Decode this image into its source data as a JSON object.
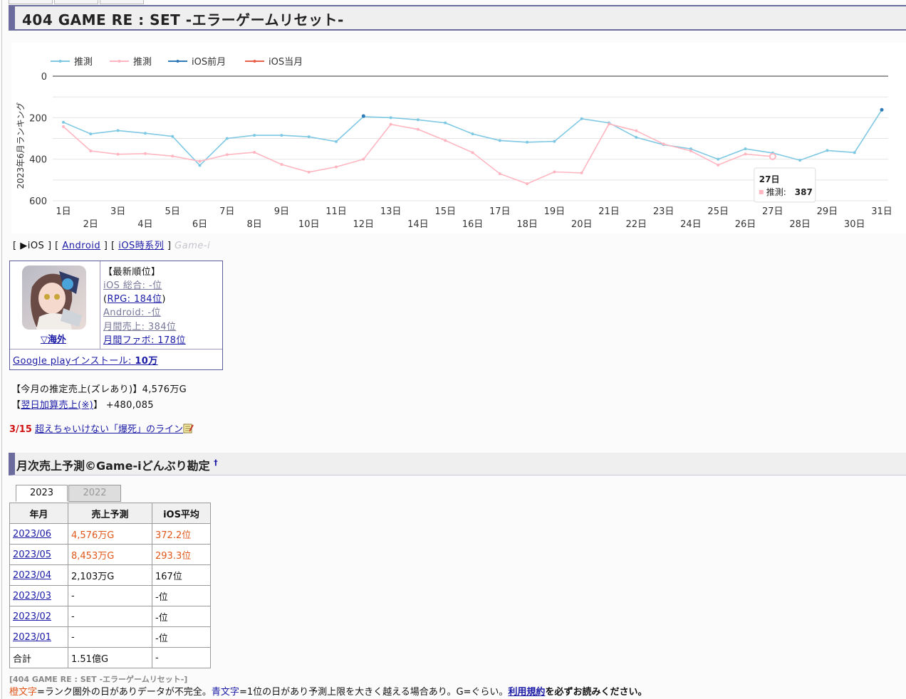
{
  "page": {
    "title": "404 GAME RE : SET -エラーゲームリセット-"
  },
  "colors": {
    "ios_estimate": "#7ec8e3",
    "android_estimate": "#ffb6c1",
    "ios_prev": "#2f7ab8",
    "ios_cur": "#e8604c",
    "accent": "#6b6b9e"
  },
  "chart_data": {
    "type": "line",
    "ylabel": "2023年6月ランキング",
    "ylim": [
      600,
      0
    ],
    "yticks": [
      0,
      200,
      400,
      600
    ],
    "categories": [
      "1日",
      "2日",
      "3日",
      "4日",
      "5日",
      "6日",
      "7日",
      "8日",
      "9日",
      "10日",
      "11日",
      "12日",
      "13日",
      "14日",
      "15日",
      "16日",
      "17日",
      "18日",
      "19日",
      "20日",
      "21日",
      "22日",
      "23日",
      "24日",
      "25日",
      "26日",
      "27日",
      "28日",
      "29日",
      "30日",
      "31日"
    ],
    "legend": [
      "推測",
      "推測",
      "iOS前月",
      "iOS当月"
    ],
    "series": [
      {
        "name": "推測",
        "color": "#7ec8e3",
        "values": [
          222,
          278,
          262,
          275,
          290,
          430,
          300,
          285,
          285,
          292,
          315,
          195,
          200,
          210,
          225,
          278,
          310,
          318,
          314,
          205,
          225,
          295,
          330,
          350,
          400,
          350,
          370,
          405,
          358,
          368,
          162
        ]
      },
      {
        "name": "推測",
        "color": "#ffb6c1",
        "values": [
          243,
          360,
          376,
          373,
          385,
          410,
          378,
          367,
          425,
          462,
          437,
          400,
          232,
          256,
          310,
          368,
          470,
          518,
          461,
          466,
          230,
          263,
          327,
          360,
          428,
          375,
          387,
          null,
          null,
          null,
          null
        ]
      },
      {
        "name": "iOS前月",
        "color": "#2f7ab8",
        "points": [
          [
            12,
            192
          ],
          [
            31,
            162
          ]
        ]
      },
      {
        "name": "iOS当月",
        "color": "#e8604c",
        "points": []
      }
    ],
    "tooltip": {
      "day": "27日",
      "label": "推測",
      "value": "387"
    }
  },
  "nav": {
    "open": "[",
    "ios": "▶iOS",
    "sep1": "] [",
    "android": "Android",
    "sep2": "] [",
    "ios_ts": "iOS時系列",
    "close": "]",
    "brand": "Game-i"
  },
  "info": {
    "region_link": "▽海外",
    "latest_header": "【最新順位】",
    "ios_total": "iOS 総合: -位",
    "rpg_open": "(",
    "rpg": "RPG: 184位",
    "rpg_close": ")",
    "android": "Android: -位",
    "monthly_sales": "月間売上: 384位",
    "monthly_famitsu": "月間ファボ: 178位",
    "gp_install_label": "Google playインストール: ",
    "gp_install_value": "10万"
  },
  "estimate": {
    "line1": "【今月の推定売上(ズレあり)】4,576万G",
    "line2_open": "【",
    "line2_link": "翌日加算売上(※)",
    "line2_rest": "】 +480,085"
  },
  "deadline": {
    "date": "3/15",
    "link": "超えちゃいけない「爆死」のライン",
    "icon": "memo-icon"
  },
  "section2": {
    "title": "月次売上予測©Game-iどんぶり勘定",
    "sup": "†"
  },
  "year_tabs": [
    "2023",
    "2022"
  ],
  "sales_table": {
    "headers": [
      "年月",
      "売上予測",
      "iOS平均"
    ],
    "rows": [
      {
        "month": "2023/06",
        "sales": "4,576万G",
        "avg": "372.2位",
        "highlight": true
      },
      {
        "month": "2023/05",
        "sales": "8,453万G",
        "avg": "293.3位",
        "highlight": true
      },
      {
        "month": "2023/04",
        "sales": "2,103万G",
        "avg": "167位",
        "highlight": false
      },
      {
        "month": "2023/03",
        "sales": "-",
        "avg": "-位",
        "highlight": false
      },
      {
        "month": "2023/02",
        "sales": "-",
        "avg": "-位",
        "highlight": false
      },
      {
        "month": "2023/01",
        "sales": "-",
        "avg": "-位",
        "highlight": false
      }
    ],
    "total": {
      "label": "合計",
      "sales": "1.51億G",
      "avg": "-"
    }
  },
  "footer": {
    "caption": "[404 GAME RE : SET -エラーゲームリセット-]",
    "orange_word": "橙文字",
    "text1": "=ランク圏外の日がありデータが不完全。",
    "blue_word": "青文字",
    "text2": "=1位の日があり予測上限を大きく越える場合あり。G=ぐらい。",
    "terms_link": "利用規約",
    "text3": "を必ずお読みください。"
  }
}
